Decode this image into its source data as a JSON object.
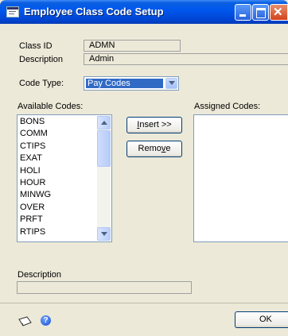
{
  "window": {
    "title": "Employee Class Code Setup"
  },
  "form": {
    "class_id_label": "Class ID",
    "class_id_value": "ADMN",
    "description_label": "Description",
    "description_value": "Admin",
    "code_type_label": "Code Type:",
    "code_type_value": "Pay Codes"
  },
  "available": {
    "label": "Available Codes:",
    "items": [
      "BONS",
      "COMM",
      "CTIPS",
      "EXAT",
      "HOLI",
      "HOUR",
      "MINWG",
      "OVER",
      "PRFT",
      "RTIPS"
    ]
  },
  "assigned": {
    "label": "Assigned Codes:",
    "items": []
  },
  "buttons": {
    "insert": "Insert >>",
    "remove": "Remove",
    "ok": "OK"
  },
  "bottom": {
    "description_label": "Description",
    "description_value": ""
  },
  "icons": [
    "window-icon",
    "minimize-icon",
    "maximize-icon",
    "close-icon",
    "dropdown-arrow-icon",
    "scroll-up-icon",
    "scroll-down-icon",
    "note-icon",
    "help-icon"
  ]
}
